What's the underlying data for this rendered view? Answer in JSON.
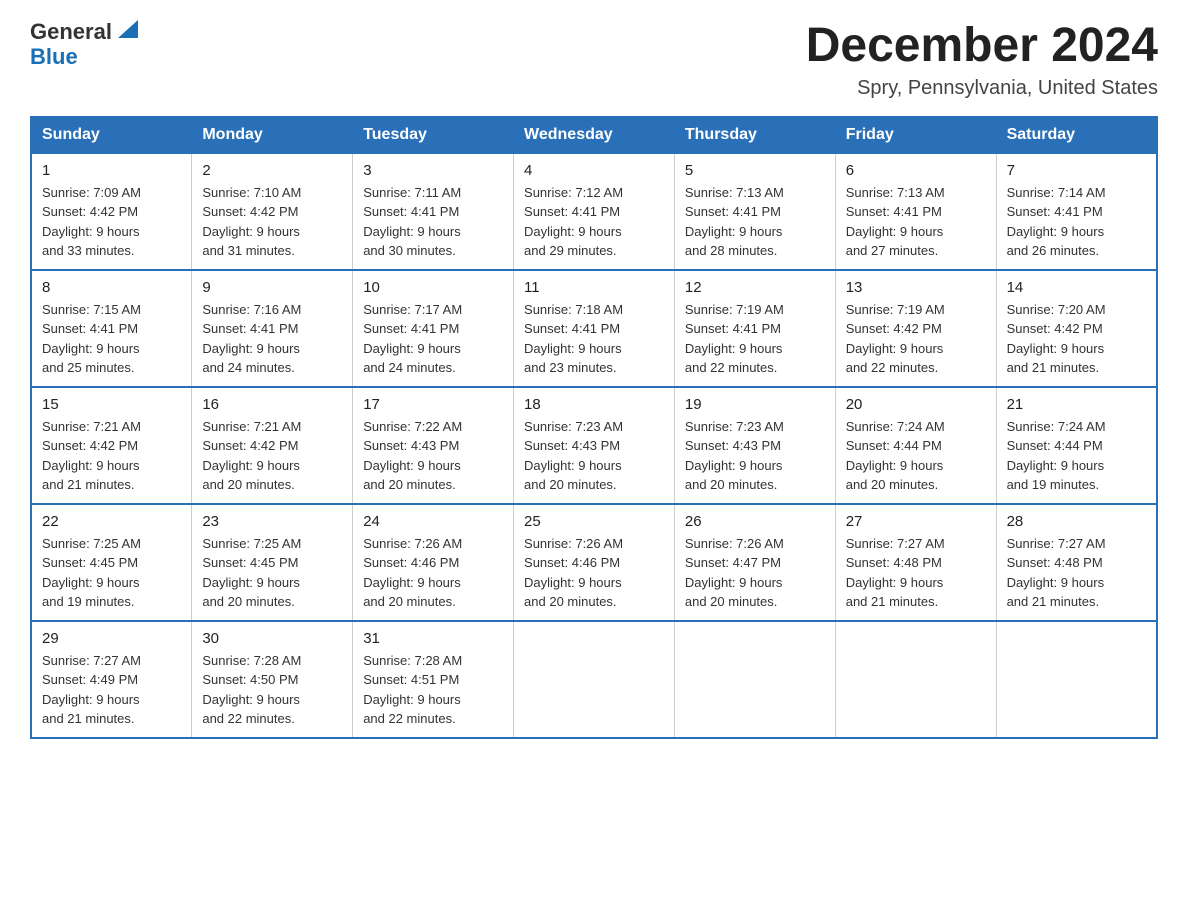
{
  "header": {
    "logo": {
      "line1": "General",
      "line2": "Blue"
    },
    "month_title": "December 2024",
    "location": "Spry, Pennsylvania, United States"
  },
  "weekdays": [
    "Sunday",
    "Monday",
    "Tuesday",
    "Wednesday",
    "Thursday",
    "Friday",
    "Saturday"
  ],
  "weeks": [
    [
      {
        "day": "1",
        "sunrise": "7:09 AM",
        "sunset": "4:42 PM",
        "daylight": "9 hours and 33 minutes."
      },
      {
        "day": "2",
        "sunrise": "7:10 AM",
        "sunset": "4:42 PM",
        "daylight": "9 hours and 31 minutes."
      },
      {
        "day": "3",
        "sunrise": "7:11 AM",
        "sunset": "4:41 PM",
        "daylight": "9 hours and 30 minutes."
      },
      {
        "day": "4",
        "sunrise": "7:12 AM",
        "sunset": "4:41 PM",
        "daylight": "9 hours and 29 minutes."
      },
      {
        "day": "5",
        "sunrise": "7:13 AM",
        "sunset": "4:41 PM",
        "daylight": "9 hours and 28 minutes."
      },
      {
        "day": "6",
        "sunrise": "7:13 AM",
        "sunset": "4:41 PM",
        "daylight": "9 hours and 27 minutes."
      },
      {
        "day": "7",
        "sunrise": "7:14 AM",
        "sunset": "4:41 PM",
        "daylight": "9 hours and 26 minutes."
      }
    ],
    [
      {
        "day": "8",
        "sunrise": "7:15 AM",
        "sunset": "4:41 PM",
        "daylight": "9 hours and 25 minutes."
      },
      {
        "day": "9",
        "sunrise": "7:16 AM",
        "sunset": "4:41 PM",
        "daylight": "9 hours and 24 minutes."
      },
      {
        "day": "10",
        "sunrise": "7:17 AM",
        "sunset": "4:41 PM",
        "daylight": "9 hours and 24 minutes."
      },
      {
        "day": "11",
        "sunrise": "7:18 AM",
        "sunset": "4:41 PM",
        "daylight": "9 hours and 23 minutes."
      },
      {
        "day": "12",
        "sunrise": "7:19 AM",
        "sunset": "4:41 PM",
        "daylight": "9 hours and 22 minutes."
      },
      {
        "day": "13",
        "sunrise": "7:19 AM",
        "sunset": "4:42 PM",
        "daylight": "9 hours and 22 minutes."
      },
      {
        "day": "14",
        "sunrise": "7:20 AM",
        "sunset": "4:42 PM",
        "daylight": "9 hours and 21 minutes."
      }
    ],
    [
      {
        "day": "15",
        "sunrise": "7:21 AM",
        "sunset": "4:42 PM",
        "daylight": "9 hours and 21 minutes."
      },
      {
        "day": "16",
        "sunrise": "7:21 AM",
        "sunset": "4:42 PM",
        "daylight": "9 hours and 20 minutes."
      },
      {
        "day": "17",
        "sunrise": "7:22 AM",
        "sunset": "4:43 PM",
        "daylight": "9 hours and 20 minutes."
      },
      {
        "day": "18",
        "sunrise": "7:23 AM",
        "sunset": "4:43 PM",
        "daylight": "9 hours and 20 minutes."
      },
      {
        "day": "19",
        "sunrise": "7:23 AM",
        "sunset": "4:43 PM",
        "daylight": "9 hours and 20 minutes."
      },
      {
        "day": "20",
        "sunrise": "7:24 AM",
        "sunset": "4:44 PM",
        "daylight": "9 hours and 20 minutes."
      },
      {
        "day": "21",
        "sunrise": "7:24 AM",
        "sunset": "4:44 PM",
        "daylight": "9 hours and 19 minutes."
      }
    ],
    [
      {
        "day": "22",
        "sunrise": "7:25 AM",
        "sunset": "4:45 PM",
        "daylight": "9 hours and 19 minutes."
      },
      {
        "day": "23",
        "sunrise": "7:25 AM",
        "sunset": "4:45 PM",
        "daylight": "9 hours and 20 minutes."
      },
      {
        "day": "24",
        "sunrise": "7:26 AM",
        "sunset": "4:46 PM",
        "daylight": "9 hours and 20 minutes."
      },
      {
        "day": "25",
        "sunrise": "7:26 AM",
        "sunset": "4:46 PM",
        "daylight": "9 hours and 20 minutes."
      },
      {
        "day": "26",
        "sunrise": "7:26 AM",
        "sunset": "4:47 PM",
        "daylight": "9 hours and 20 minutes."
      },
      {
        "day": "27",
        "sunrise": "7:27 AM",
        "sunset": "4:48 PM",
        "daylight": "9 hours and 21 minutes."
      },
      {
        "day": "28",
        "sunrise": "7:27 AM",
        "sunset": "4:48 PM",
        "daylight": "9 hours and 21 minutes."
      }
    ],
    [
      {
        "day": "29",
        "sunrise": "7:27 AM",
        "sunset": "4:49 PM",
        "daylight": "9 hours and 21 minutes."
      },
      {
        "day": "30",
        "sunrise": "7:28 AM",
        "sunset": "4:50 PM",
        "daylight": "9 hours and 22 minutes."
      },
      {
        "day": "31",
        "sunrise": "7:28 AM",
        "sunset": "4:51 PM",
        "daylight": "9 hours and 22 minutes."
      },
      null,
      null,
      null,
      null
    ]
  ],
  "labels": {
    "sunrise": "Sunrise:",
    "sunset": "Sunset:",
    "daylight": "Daylight:"
  }
}
